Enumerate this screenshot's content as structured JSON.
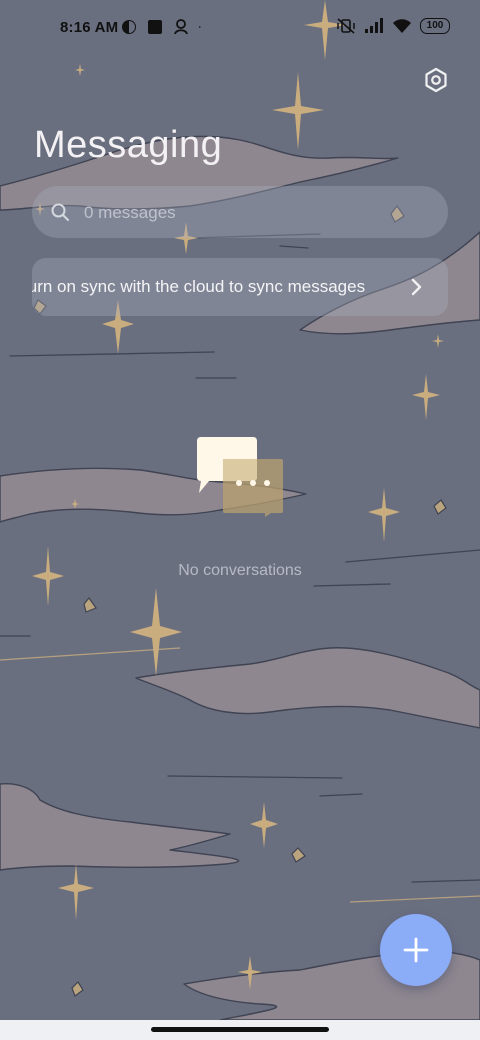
{
  "status_bar": {
    "time": "8:16 AM",
    "battery": "100",
    "icons_left": [
      "vpn-key-icon",
      "app-square-icon",
      "location-person-icon",
      "dot-icon"
    ],
    "icons_right": [
      "vibrate-off-icon",
      "signal-icon",
      "wifi-icon",
      "battery-icon"
    ]
  },
  "header": {
    "title": "Messaging",
    "settings_icon": "settings-hexagon-icon"
  },
  "search": {
    "placeholder": "0 messages",
    "icon": "search-icon"
  },
  "sync_banner": {
    "text": "Turn on sync with the cloud to sync messages",
    "icon": "chevron-right-icon"
  },
  "empty_state": {
    "icon": "chat-bubbles-icon",
    "text": "No conversations"
  },
  "fab": {
    "icon": "plus-icon"
  },
  "colors": {
    "background": "#6a6f80",
    "clouds": "#8e8790",
    "stars": "#c9ad7e",
    "fab": "#8bacf6",
    "title": "#f3f1f3"
  }
}
